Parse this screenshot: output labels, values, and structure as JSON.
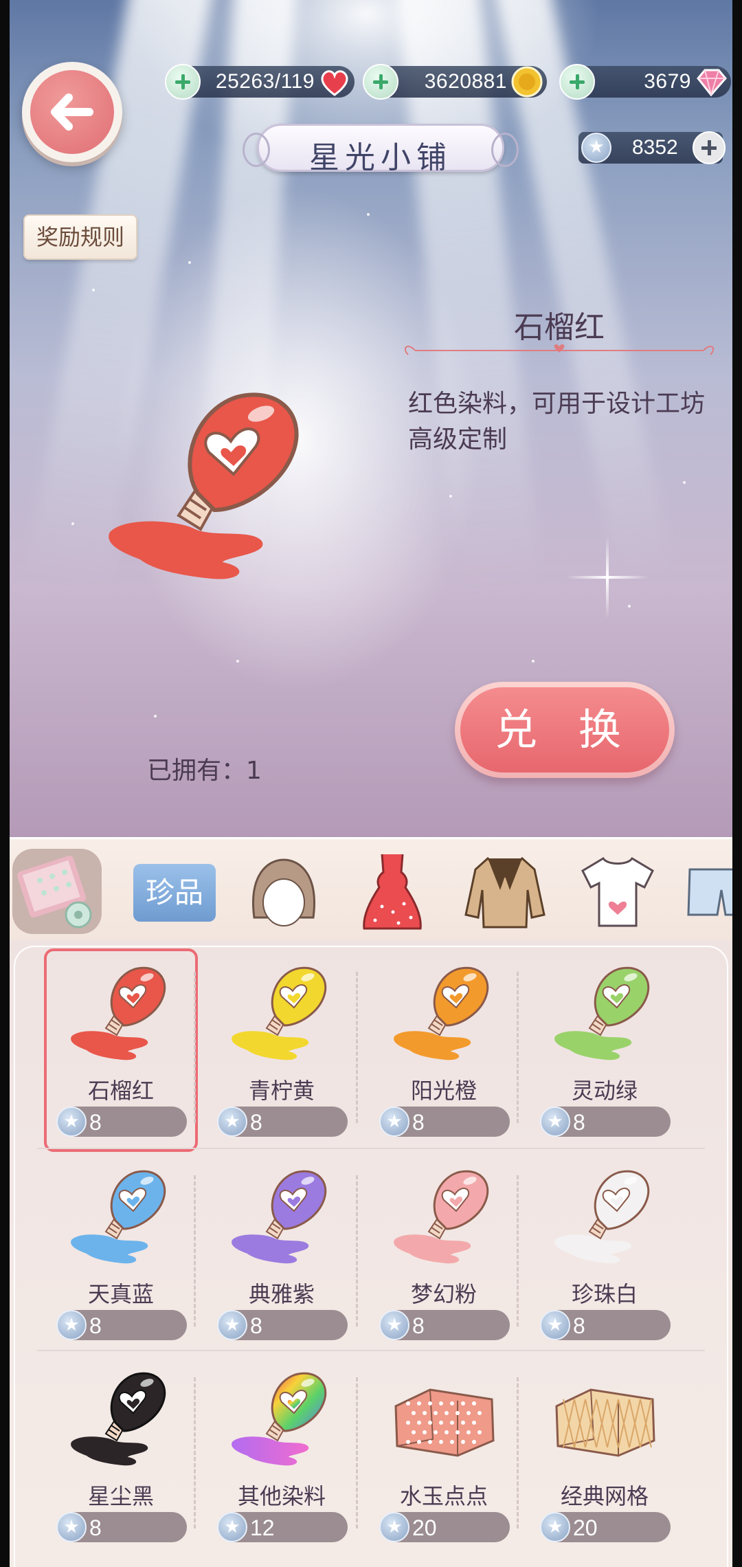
{
  "header": {
    "title": "星光小铺",
    "stamina": "25263/119",
    "coins": "3620881",
    "diamonds": "3679",
    "star_currency": "8352"
  },
  "rules_button": "奖励规则",
  "selected_item": {
    "name": "石榴红",
    "description": "红色染料，可用于设计工坊高级定制",
    "owned_label": "已拥有：",
    "owned_count": "1",
    "color": "#e8574a"
  },
  "exchange_button": "兑 换",
  "categories": [
    {
      "id": "fabric",
      "label": "",
      "icon": "fabric-icon"
    },
    {
      "id": "treasure",
      "label": "珍品",
      "icon": "treasure-tab"
    },
    {
      "id": "hair",
      "label": "",
      "icon": "hair-icon"
    },
    {
      "id": "dress",
      "label": "",
      "icon": "dress-icon"
    },
    {
      "id": "coat",
      "label": "",
      "icon": "coat-icon"
    },
    {
      "id": "top",
      "label": "",
      "icon": "tshirt-icon"
    },
    {
      "id": "bottom",
      "label": "",
      "icon": "pants-icon"
    }
  ],
  "items": [
    {
      "name": "石榴红",
      "price": "8",
      "color": "#e8574a",
      "kind": "dye"
    },
    {
      "name": "青柠黄",
      "price": "8",
      "color": "#f2d72e",
      "kind": "dye"
    },
    {
      "name": "阳光橙",
      "price": "8",
      "color": "#f39a2c",
      "kind": "dye"
    },
    {
      "name": "灵动绿",
      "price": "8",
      "color": "#9ad26a",
      "kind": "dye"
    },
    {
      "name": "天真蓝",
      "price": "8",
      "color": "#6cb3ec",
      "kind": "dye"
    },
    {
      "name": "典雅紫",
      "price": "8",
      "color": "#9b7be0",
      "kind": "dye"
    },
    {
      "name": "梦幻粉",
      "price": "8",
      "color": "#f3a9ab",
      "kind": "dye"
    },
    {
      "name": "珍珠白",
      "price": "8",
      "color": "#f3f1f1",
      "kind": "dye"
    },
    {
      "name": "星尘黑",
      "price": "8",
      "color": "#2b2528",
      "kind": "dye"
    },
    {
      "name": "其他染料",
      "price": "12",
      "color": "rainbow",
      "kind": "dye"
    },
    {
      "name": "水玉点点",
      "price": "20",
      "color": "#f09a8a",
      "kind": "cloth-dots"
    },
    {
      "name": "经典网格",
      "price": "20",
      "color": "#f3d6a8",
      "kind": "cloth-grid"
    }
  ],
  "colors": {
    "accent": "#e7676e",
    "text": "#4b3b52",
    "price_bg": "#9b8d91"
  }
}
